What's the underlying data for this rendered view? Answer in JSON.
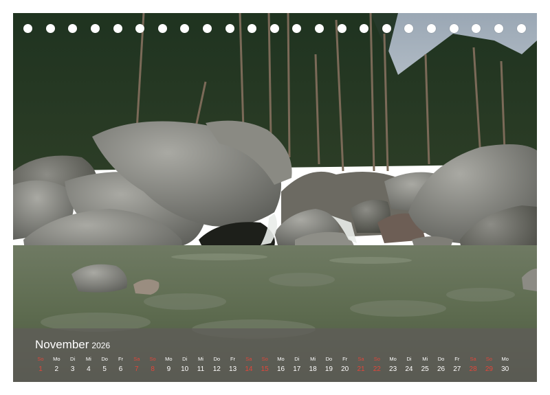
{
  "calendar": {
    "month": "November",
    "year": "2026",
    "days": [
      {
        "dow": "So",
        "day": "1",
        "weekend": true
      },
      {
        "dow": "Mo",
        "day": "2",
        "weekend": false
      },
      {
        "dow": "Di",
        "day": "3",
        "weekend": false
      },
      {
        "dow": "Mi",
        "day": "4",
        "weekend": false
      },
      {
        "dow": "Do",
        "day": "5",
        "weekend": false
      },
      {
        "dow": "Fr",
        "day": "6",
        "weekend": false
      },
      {
        "dow": "Sa",
        "day": "7",
        "weekend": true
      },
      {
        "dow": "So",
        "day": "8",
        "weekend": true
      },
      {
        "dow": "Mo",
        "day": "9",
        "weekend": false
      },
      {
        "dow": "Di",
        "day": "10",
        "weekend": false
      },
      {
        "dow": "Mi",
        "day": "11",
        "weekend": false
      },
      {
        "dow": "Do",
        "day": "12",
        "weekend": false
      },
      {
        "dow": "Fr",
        "day": "13",
        "weekend": false
      },
      {
        "dow": "Sa",
        "day": "14",
        "weekend": true
      },
      {
        "dow": "So",
        "day": "15",
        "weekend": true
      },
      {
        "dow": "Mo",
        "day": "16",
        "weekend": false
      },
      {
        "dow": "Di",
        "day": "17",
        "weekend": false
      },
      {
        "dow": "Mi",
        "day": "18",
        "weekend": false
      },
      {
        "dow": "Do",
        "day": "19",
        "weekend": false
      },
      {
        "dow": "Fr",
        "day": "20",
        "weekend": false
      },
      {
        "dow": "Sa",
        "day": "21",
        "weekend": true
      },
      {
        "dow": "So",
        "day": "22",
        "weekend": true
      },
      {
        "dow": "Mo",
        "day": "23",
        "weekend": false
      },
      {
        "dow": "Di",
        "day": "24",
        "weekend": false
      },
      {
        "dow": "Mi",
        "day": "25",
        "weekend": false
      },
      {
        "dow": "Do",
        "day": "26",
        "weekend": false
      },
      {
        "dow": "Fr",
        "day": "27",
        "weekend": false
      },
      {
        "dow": "Sa",
        "day": "28",
        "weekend": true
      },
      {
        "dow": "So",
        "day": "29",
        "weekend": true
      },
      {
        "dow": "Mo",
        "day": "30",
        "weekend": false
      }
    ]
  },
  "colors": {
    "weekend": "#e2463a",
    "weekday": "#ffffff",
    "band": "#5f5c58"
  }
}
